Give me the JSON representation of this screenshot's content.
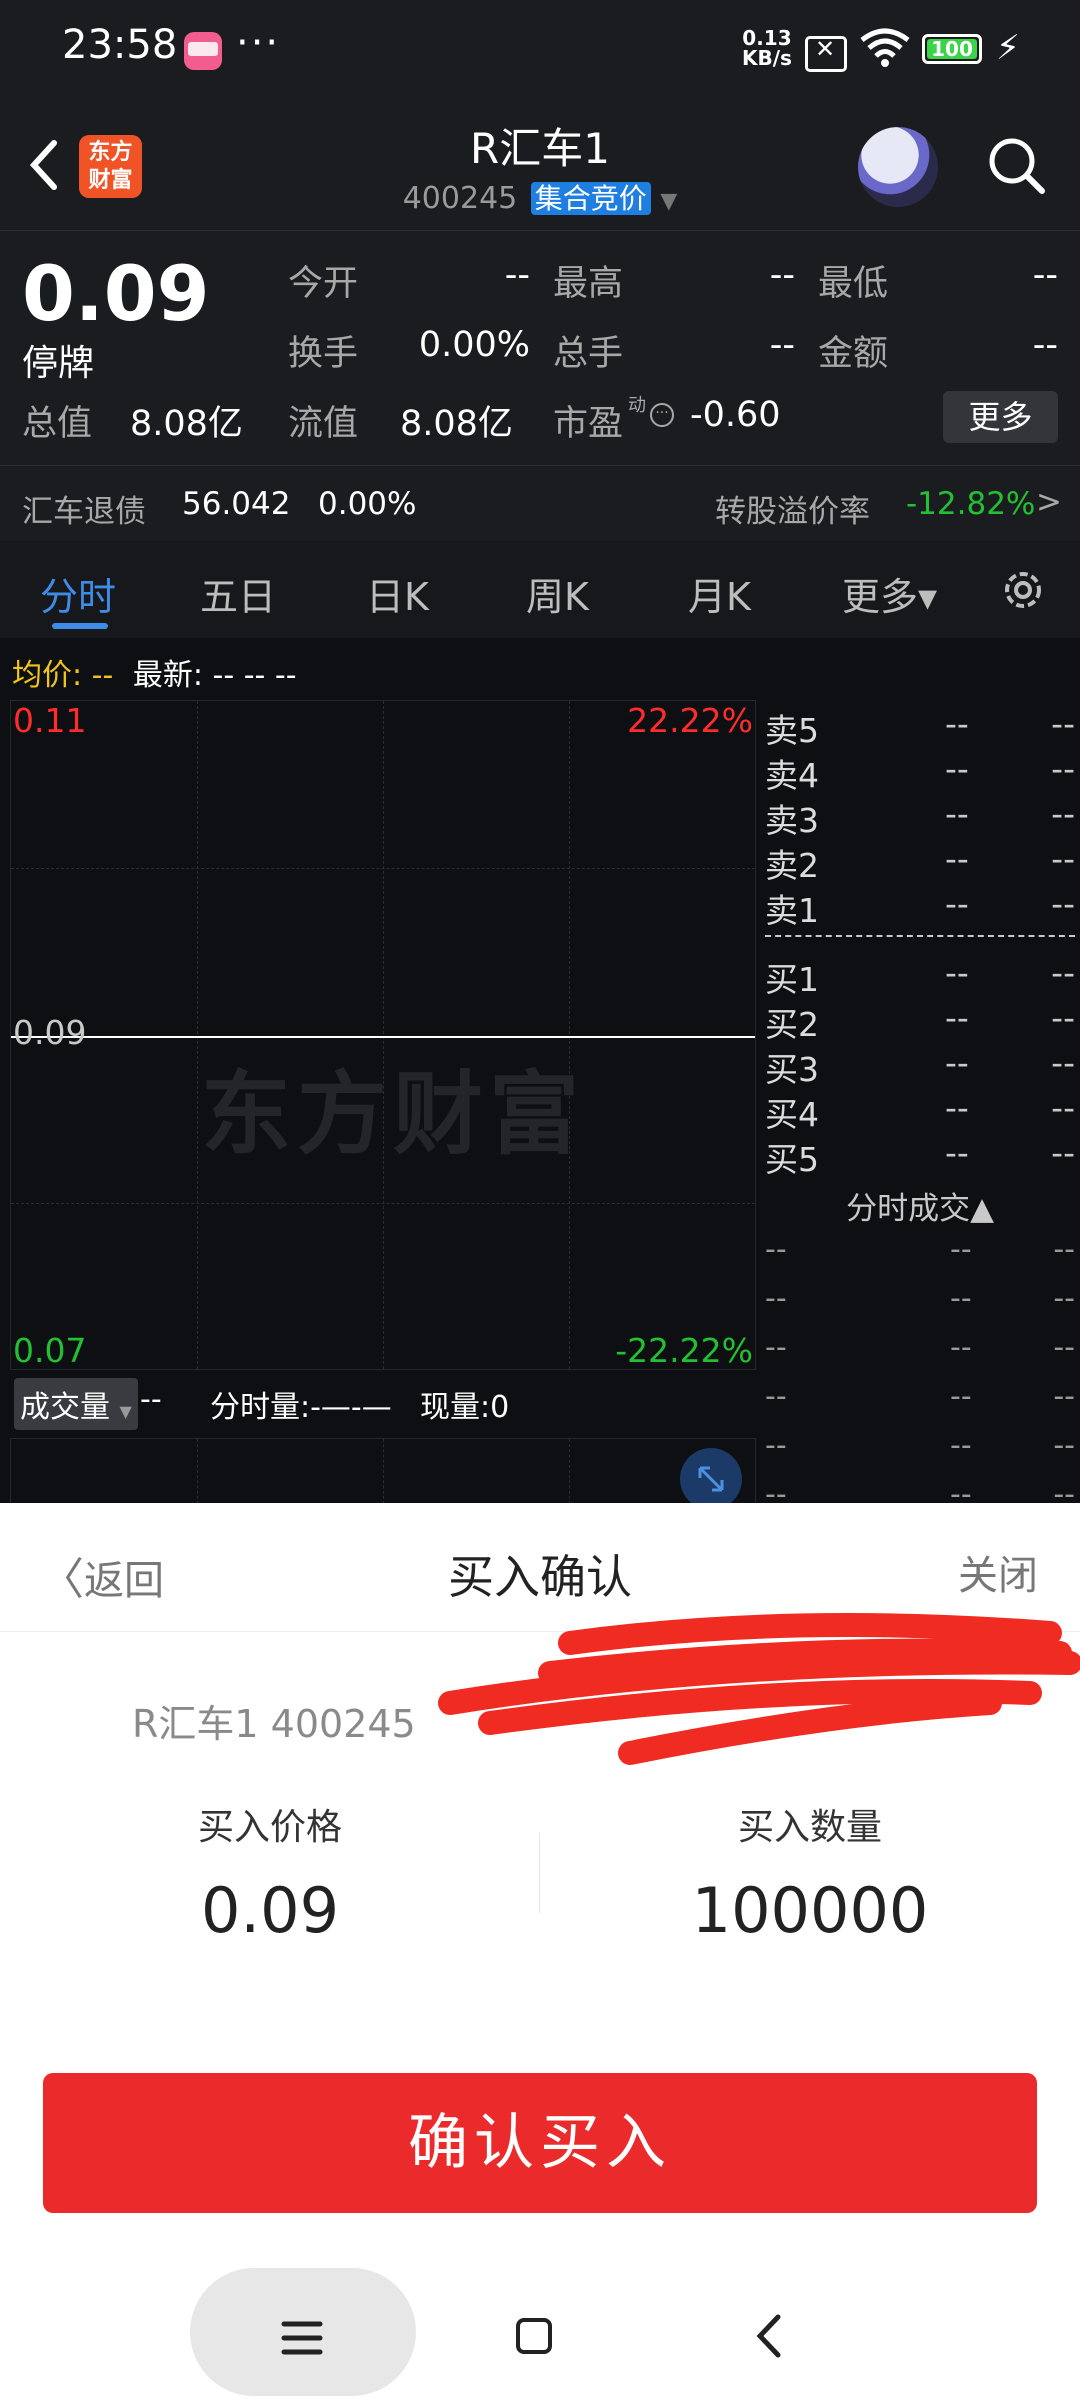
{
  "status_bar": {
    "time": "23:58",
    "notification_dots": "···",
    "net_speed_value": "0.13",
    "net_speed_unit": "KB/s",
    "battery": "100"
  },
  "header": {
    "logo_text": "东方财富",
    "title": "R汇车1",
    "code": "400245",
    "auction_tag": "集合竞价"
  },
  "quote": {
    "price": "0.09",
    "status": "停牌",
    "rows": [
      [
        {
          "label": "今开",
          "value": "--"
        },
        {
          "label": "最高",
          "value": "--"
        },
        {
          "label": "最低",
          "value": "--"
        }
      ],
      [
        {
          "label": "换手",
          "value": "0.00%"
        },
        {
          "label": "总手",
          "value": "--"
        },
        {
          "label": "金额",
          "value": "--"
        }
      ]
    ],
    "total_value_label": "总值",
    "total_value": "8.08亿",
    "float_value_label": "流值",
    "float_value": "8.08亿",
    "pe_label": "市盈",
    "pe_superscript": "动",
    "pe_value": "-0.60",
    "more_button": "更多"
  },
  "bond_row": {
    "name": "汇车退债",
    "price": "56.042",
    "change": "0.00%",
    "premium_label": "转股溢价率",
    "premium_value": "-12.82%",
    "arrow": ">"
  },
  "tabs": [
    {
      "label": "分时",
      "active": true
    },
    {
      "label": "五日",
      "active": false
    },
    {
      "label": "日K",
      "active": false
    },
    {
      "label": "周K",
      "active": false
    },
    {
      "label": "月K",
      "active": false
    },
    {
      "label": "更多▾",
      "active": false
    }
  ],
  "chart": {
    "avg_label": "均价:",
    "avg_value": "--",
    "latest_label": "最新:",
    "latest_values": "--  --  --",
    "top_price": "0.11",
    "top_pct": "22.22%",
    "mid_price": "0.09",
    "bottom_price": "0.07",
    "bottom_pct": "-22.22%",
    "watermark": "东方财富",
    "volume_dropdown": "成交量",
    "volume_value": "--",
    "minute_volume": "分时量:-—-—",
    "current_volume": "现量:0"
  },
  "order_book": {
    "sell": [
      {
        "name": "卖5",
        "price": "--",
        "vol": "--"
      },
      {
        "name": "卖4",
        "price": "--",
        "vol": "--"
      },
      {
        "name": "卖3",
        "price": "--",
        "vol": "--"
      },
      {
        "name": "卖2",
        "price": "--",
        "vol": "--"
      },
      {
        "name": "卖1",
        "price": "--",
        "vol": "--"
      }
    ],
    "buy": [
      {
        "name": "买1",
        "price": "--",
        "vol": "--"
      },
      {
        "name": "买2",
        "price": "--",
        "vol": "--"
      },
      {
        "name": "买3",
        "price": "--",
        "vol": "--"
      },
      {
        "name": "买4",
        "price": "--",
        "vol": "--"
      },
      {
        "name": "买5",
        "price": "--",
        "vol": "--"
      }
    ],
    "ticks_header": "分时成交▲",
    "ticks": [
      [
        "--",
        "--",
        "--"
      ],
      [
        "--",
        "--",
        "--"
      ],
      [
        "--",
        "--",
        "--"
      ],
      [
        "--",
        "--",
        "--"
      ],
      [
        "--",
        "--",
        "--"
      ],
      [
        "--",
        "--",
        "--"
      ]
    ]
  },
  "modal": {
    "back_label": "返回",
    "title": "买入确认",
    "close_label": "关闭",
    "stock": "R汇车1 400245",
    "price_label": "买入价格",
    "price_value": "0.09",
    "qty_label": "买入数量",
    "qty_value": "100000",
    "confirm_button": "确认买入"
  }
}
